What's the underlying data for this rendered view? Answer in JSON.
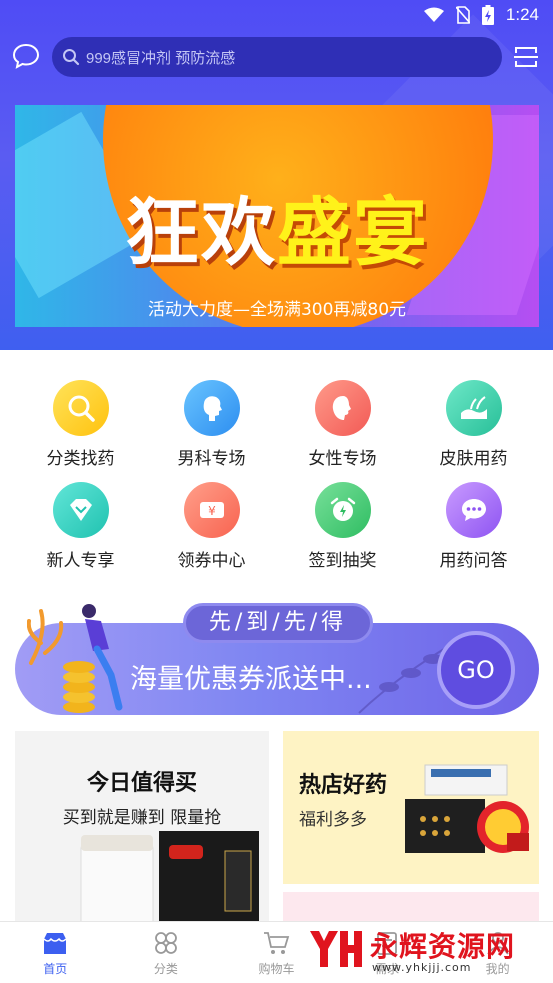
{
  "status_bar": {
    "time": "1:24"
  },
  "search": {
    "placeholder": "999感冒冲剂  预防流感"
  },
  "banner": {
    "title_white": "狂欢",
    "title_yellow": "盛宴",
    "subtitle": "活动大力度—全场满300再减80元"
  },
  "categories": [
    {
      "label": "分类找药",
      "icon": "search-icon",
      "color": "#ffc20e"
    },
    {
      "label": "男科专场",
      "icon": "male-profile-icon",
      "color": "#2d8ef0"
    },
    {
      "label": "女性专场",
      "icon": "female-profile-icon",
      "color": "#f25a55"
    },
    {
      "label": "皮肤用药",
      "icon": "skin-icon",
      "color": "#27bf98"
    },
    {
      "label": "新人专享",
      "icon": "diamond-icon",
      "color": "#20c2b0"
    },
    {
      "label": "领券中心",
      "icon": "coupon-icon",
      "color": "#f86350"
    },
    {
      "label": "签到抽奖",
      "icon": "alarm-clock-icon",
      "color": "#2fbd62"
    },
    {
      "label": "用药问答",
      "icon": "chat-bubble-icon",
      "color": "#8e54f2"
    }
  ],
  "promo": {
    "tag": "先/到/先/得",
    "text": "海量优惠券派送中...",
    "button": "GO"
  },
  "cards": {
    "left": {
      "title": "今日值得买",
      "subtitle": "买到就是赚到 限量抢"
    },
    "right": {
      "title": "热店好药",
      "subtitle": "福利多多"
    }
  },
  "bottom_nav": [
    {
      "label": "首页",
      "icon": "home-icon",
      "active": true
    },
    {
      "label": "分类",
      "icon": "category-icon",
      "active": false
    },
    {
      "label": "购物车",
      "icon": "cart-icon",
      "active": false
    },
    {
      "label": "需求",
      "icon": "list-icon",
      "active": false
    },
    {
      "label": "我的",
      "icon": "user-icon",
      "active": false
    }
  ],
  "watermark": {
    "name": "永辉资源网",
    "url": "www.yhkjjj.com"
  },
  "colors": {
    "header": "#4f4cf5",
    "accent": "#3c5ff0",
    "watermark": "#e0141e"
  }
}
